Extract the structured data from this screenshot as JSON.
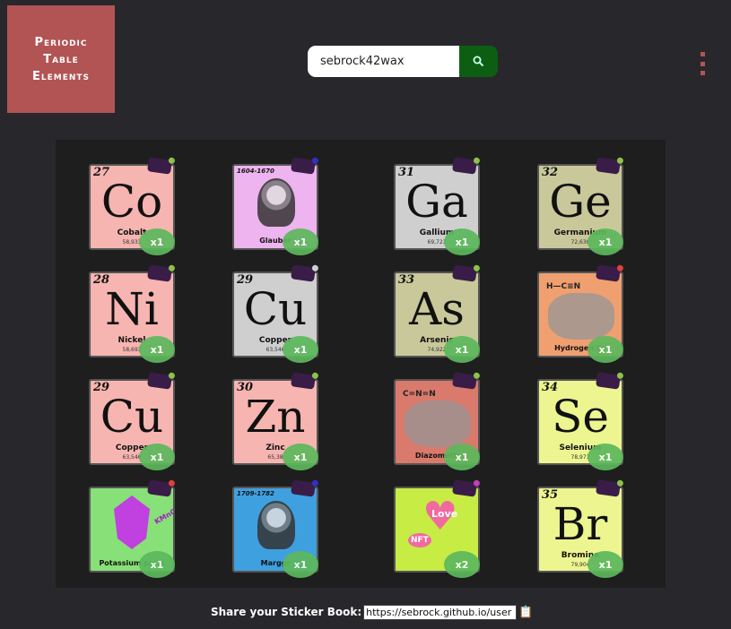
{
  "logo": {
    "line1": "Periodic",
    "line2": "Table",
    "line3": "Elements"
  },
  "search": {
    "value": "sebrock42wax",
    "button_icon": "search-icon"
  },
  "menu_icon": "kebab-menu-icon",
  "stickers": [
    {
      "kind": "element",
      "number": "27",
      "symbol": "Co",
      "name": "Cobalt",
      "mass": "58,933",
      "count": "x1",
      "bg": "#f6b5b0",
      "chip": "#8bc34a"
    },
    {
      "kind": "person",
      "years": "1604-1670",
      "caption": "Glauber",
      "count": "x1",
      "bg": "#eeb4ef",
      "chip": "#3030c8"
    },
    {
      "kind": "element",
      "number": "31",
      "symbol": "Ga",
      "name": "Gallium",
      "mass": "69,723",
      "count": "x1",
      "bg": "#cfcfcf",
      "chip": "#8bc34a"
    },
    {
      "kind": "element",
      "number": "32",
      "symbol": "Ge",
      "name": "Germanium",
      "mass": "72,630",
      "count": "x1",
      "bg": "#c9c89a",
      "chip": "#8bc34a"
    },
    {
      "kind": "element",
      "number": "28",
      "symbol": "Ni",
      "name": "Nickel",
      "mass": "58,693",
      "count": "x1",
      "bg": "#f6b5b0",
      "chip": "#8bc34a"
    },
    {
      "kind": "element",
      "number": "29",
      "symbol": "Cu",
      "name": "Copper",
      "mass": "63,546",
      "count": "x1",
      "bg": "#cfcfcf",
      "chip": "#cfcfcf"
    },
    {
      "kind": "element",
      "number": "33",
      "symbol": "As",
      "name": "Arsenic",
      "mass": "74,922",
      "count": "x1",
      "bg": "#c9c89a",
      "chip": "#8bc34a"
    },
    {
      "kind": "compound",
      "caption": "Hydrogen Cy",
      "formula": "H—C≡N",
      "count": "x1",
      "bg": "#f0a070",
      "chip": "#e04040"
    },
    {
      "kind": "element",
      "number": "29",
      "symbol": "Cu",
      "name": "Copper",
      "mass": "63,546",
      "count": "x1",
      "bg": "#f6b5b0",
      "chip": "#8bc34a"
    },
    {
      "kind": "element",
      "number": "30",
      "symbol": "Zn",
      "name": "Zinc",
      "mass": "65,38",
      "count": "x1",
      "bg": "#f6b5b0",
      "chip": "#8bc34a"
    },
    {
      "kind": "compound",
      "caption": "Diazometh",
      "formula": "C=N=N",
      "count": "x1",
      "bg": "#d97a6c",
      "chip": "#8bc34a"
    },
    {
      "kind": "element",
      "number": "34",
      "symbol": "Se",
      "name": "Selenium",
      "mass": "78,971",
      "count": "x1",
      "bg": "#ecf590",
      "chip": "#8bc34a"
    },
    {
      "kind": "crystal",
      "caption": "Potassium perm",
      "formula": "KMnO₄",
      "count": "x1",
      "bg": "#88e078",
      "chip": "#e04040"
    },
    {
      "kind": "person",
      "years": "1709-1782",
      "caption": "Marggr",
      "count": "x1",
      "bg": "#3fa0e0",
      "chip": "#3030c8"
    },
    {
      "kind": "love",
      "caption": "Love",
      "heart_text": "NFT",
      "count": "x2",
      "bg": "#c7ec44",
      "chip": "#c040c0"
    },
    {
      "kind": "element",
      "number": "35",
      "symbol": "Br",
      "name": "Bromine",
      "mass": "79,904",
      "count": "x1",
      "bg": "#ecf590",
      "chip": "#8bc34a"
    }
  ],
  "share": {
    "label": "Share your Sticker Book:",
    "url": "https://sebrock.github.io/user",
    "copy_icon": "clipboard-icon"
  }
}
